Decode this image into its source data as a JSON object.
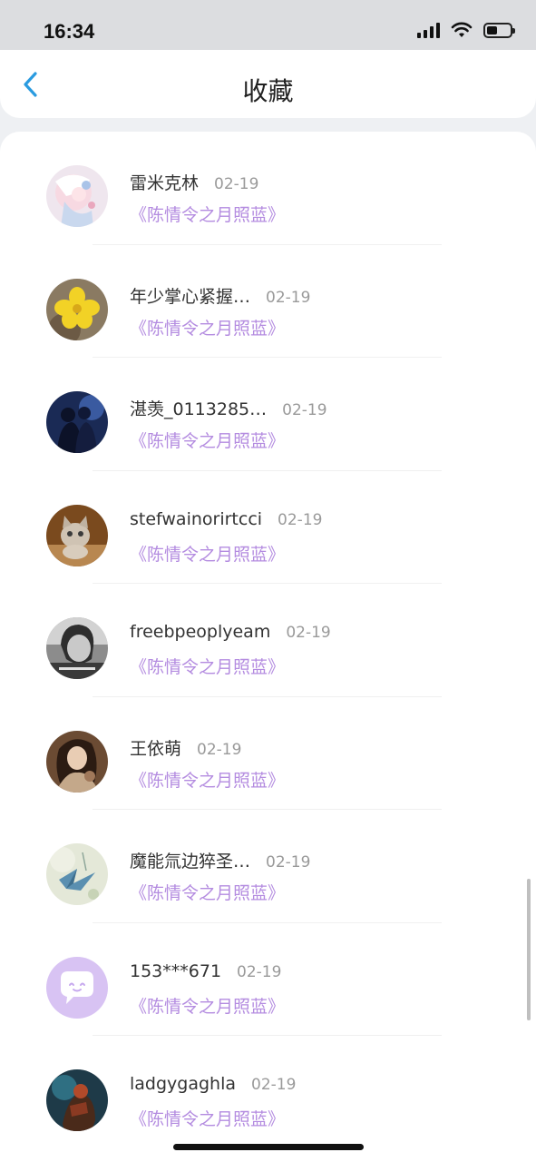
{
  "status": {
    "time": "16:34"
  },
  "nav": {
    "title": "收藏",
    "back_icon": "chevron-left-icon",
    "accent": "#2a9be0"
  },
  "work_color": "#b48ce0",
  "items": [
    {
      "name": "雷米克林",
      "date": "02-19",
      "work": "《陈情令之月照蓝》",
      "avatar": "anime-girl"
    },
    {
      "name": "年少掌心紧握…",
      "date": "02-19",
      "work": "《陈情令之月照蓝》",
      "avatar": "yellow-flower"
    },
    {
      "name": "湛羡_0113285…",
      "date": "02-19",
      "work": "《陈情令之月照蓝》",
      "avatar": "dark-couple"
    },
    {
      "name": "stefwainorirtcci",
      "date": "02-19",
      "work": "《陈情令之月照蓝》",
      "avatar": "kitten"
    },
    {
      "name": "freebpeoplyeam",
      "date": "02-19",
      "work": "《陈情令之月照蓝》",
      "avatar": "grayscale-portrait"
    },
    {
      "name": "王依萌",
      "date": "02-19",
      "work": "《陈情令之月照蓝》",
      "avatar": "girl-portrait"
    },
    {
      "name": "魔能氚边猝圣…",
      "date": "02-19",
      "work": "《陈情令之月照蓝》",
      "avatar": "paper-crane"
    },
    {
      "name": "153***671",
      "date": "02-19",
      "work": "《陈情令之月照蓝》",
      "avatar": "default-chat-bubble"
    },
    {
      "name": "ladgygaghla",
      "date": "02-19",
      "work": "《陈情令之月照蓝》",
      "avatar": "game-character"
    }
  ]
}
